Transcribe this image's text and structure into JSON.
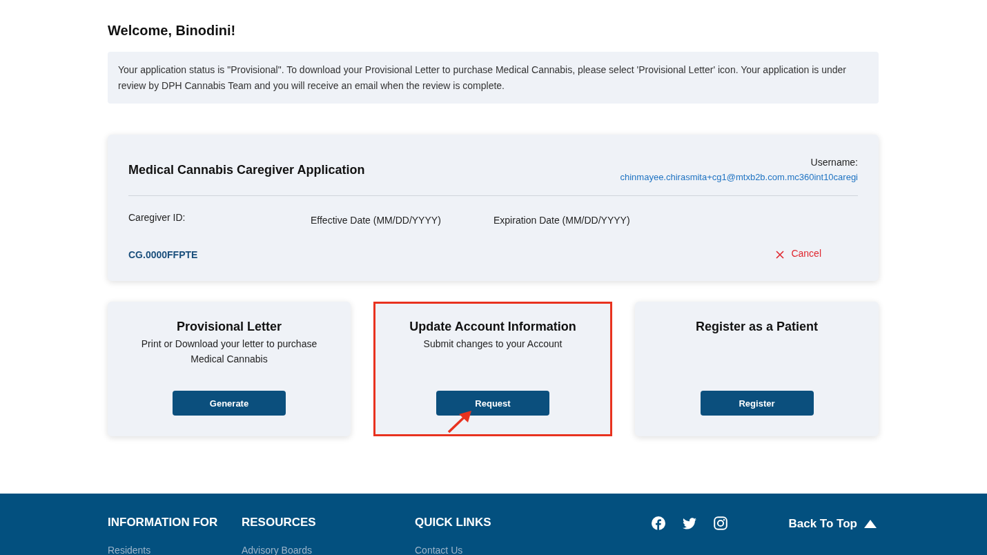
{
  "greeting": "Welcome, Binodini!",
  "notice": "Your application status is \"Provisional\". To download your Provisional Letter to purchase Medical Cannabis, please select 'Provisional Letter' icon. Your application is under review by DPH Cannabis Team and you will receive an email when the review is complete.",
  "application": {
    "title": "Medical Cannabis Caregiver Application",
    "username_label": "Username:",
    "username": "chinmayee.chirasmita+cg1@mtxb2b.com.mc360int10caregi",
    "fields": [
      {
        "label": "Caregiver ID:"
      },
      {
        "label": "Effective Date (MM/DD/YYYY)"
      },
      {
        "label": "Expiration Date (MM/DD/YYYY)"
      }
    ],
    "caregiver_id": "CG.0000FFPTE",
    "cancel": "Cancel"
  },
  "cards": [
    {
      "title": "Provisional Letter",
      "description": "Print or Download your letter to purchase Medical Cannabis",
      "button": "Generate",
      "highlighted": false
    },
    {
      "title": "Update Account Information",
      "description": "Submit changes to your Account",
      "button": "Request",
      "highlighted": true
    },
    {
      "title": "Register as a Patient",
      "button": "Register",
      "highlighted": false
    }
  ],
  "footer": {
    "columns": [
      {
        "heading": "INFORMATION FOR",
        "links": [
          "Residents"
        ]
      },
      {
        "heading": "RESOURCES",
        "links": [
          "Advisory Boards"
        ]
      },
      {
        "heading": "QUICK LINKS",
        "links": [
          "Contact Us"
        ]
      }
    ],
    "back_to_top": "Back To Top"
  }
}
